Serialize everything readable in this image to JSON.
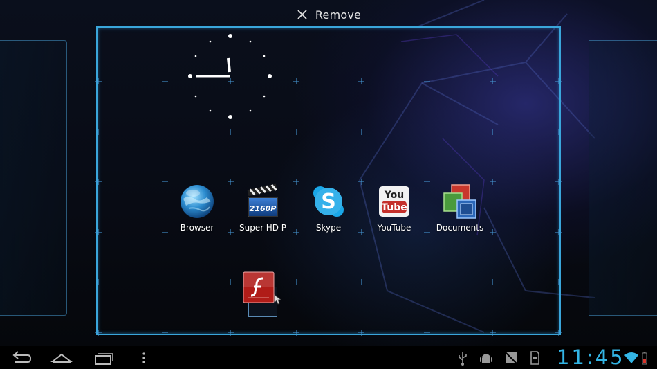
{
  "top_bar": {
    "remove_label": "Remove"
  },
  "apps": [
    {
      "label": "Browser",
      "icon": "globe-icon"
    },
    {
      "label": "Super-HD P",
      "icon": "clapperboard-icon"
    },
    {
      "label": "Skype",
      "icon": "skype-icon"
    },
    {
      "label": "YouTube",
      "icon": "youtube-icon"
    },
    {
      "label": "Documents",
      "icon": "documents-icon"
    }
  ],
  "dragging_item": {
    "icon": "flash-icon"
  },
  "status_bar": {
    "time": "11:45",
    "accent_color": "#33b5e5"
  },
  "nav_buttons": [
    "back-icon",
    "home-icon",
    "recent-apps-icon",
    "menu-icon"
  ]
}
